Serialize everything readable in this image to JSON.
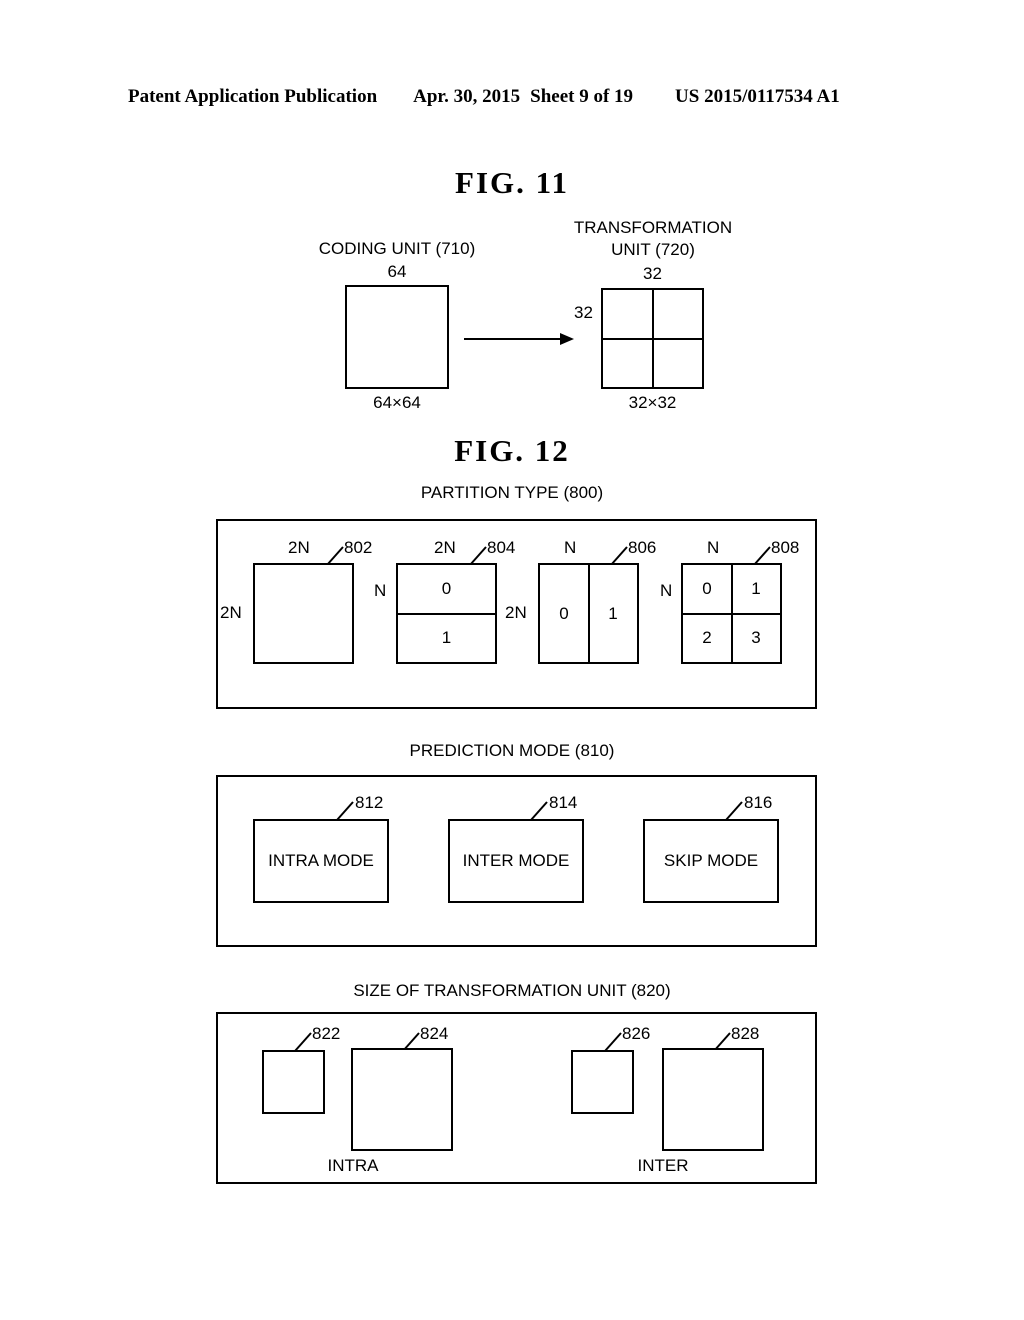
{
  "header": {
    "publication": "Patent Application Publication",
    "date": "Apr. 30, 2015",
    "sheet": "Sheet 9 of 19",
    "patent_number": "US 2015/0117534 A1"
  },
  "fig11": {
    "title": "FIG.  11",
    "coding_unit_label": "CODING UNIT (710)",
    "coding_unit_top_dim": "64",
    "coding_unit_bottom_dim": "64×64",
    "transformation_unit_label_line1": "TRANSFORMATION",
    "transformation_unit_label_line2": "UNIT (720)",
    "transformation_unit_top_dim": "32",
    "transformation_unit_left_dim": "32",
    "transformation_unit_bottom_dim": "32×32",
    "arrow": "right-arrow"
  },
  "fig12": {
    "title": "FIG.  12",
    "partition_type": {
      "section_label": "PARTITION TYPE  (800)",
      "items": [
        {
          "ref": "802",
          "top_dim": "2N",
          "left_dim": "2N",
          "layout": "single",
          "cells": []
        },
        {
          "ref": "804",
          "top_dim": "2N",
          "left_dim": "N",
          "layout": "horizontal-split",
          "cells": [
            "0",
            "1"
          ]
        },
        {
          "ref": "806",
          "top_dim": "N",
          "left_dim": "2N",
          "layout": "vertical-split",
          "cells": [
            "0",
            "1"
          ]
        },
        {
          "ref": "808",
          "top_dim": "N",
          "left_dim": "N",
          "layout": "quad-split",
          "cells": [
            "0",
            "1",
            "2",
            "3"
          ]
        }
      ]
    },
    "prediction_mode": {
      "section_label": "PREDICTION MODE (810)",
      "items": [
        {
          "ref": "812",
          "label": "INTRA MODE"
        },
        {
          "ref": "814",
          "label": "INTER MODE"
        },
        {
          "ref": "816",
          "label": "SKIP MODE"
        }
      ]
    },
    "transformation_unit_size": {
      "section_label": "SIZE OF TRANSFORMATION UNIT (820)",
      "groups": [
        {
          "caption": "INTRA",
          "items": [
            {
              "ref": "822",
              "size": "small"
            },
            {
              "ref": "824",
              "size": "large"
            }
          ]
        },
        {
          "caption": "INTER",
          "items": [
            {
              "ref": "826",
              "size": "small"
            },
            {
              "ref": "828",
              "size": "large"
            }
          ]
        }
      ]
    }
  },
  "colors": {
    "ink": "#000000",
    "paper": "#ffffff"
  }
}
